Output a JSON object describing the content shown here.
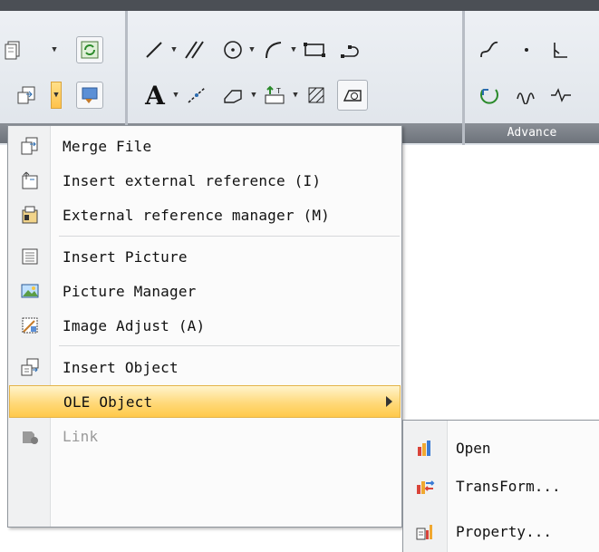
{
  "ribbon": {
    "panel_label": "Advance",
    "text_button": "A",
    "icons": {
      "row1": [
        "file-stack-icon",
        "refresh-icon",
        "line-icon",
        "parallel-lines-icon",
        "circle-icon",
        "arc-icon",
        "rectangle-icon",
        "polyline-icon",
        "spline-icon",
        "point-icon",
        "polygon-line-icon"
      ],
      "row2": [
        "insert-block-icon",
        "paint-icon",
        "text-icon",
        "construction-line-icon",
        "region-icon",
        "attribute-icon",
        "hatch-icon",
        "boundary-icon",
        "revolve-icon",
        "wave-icon",
        "zigzag-icon"
      ]
    }
  },
  "menu": {
    "items": [
      {
        "label": "Merge File",
        "icon": "merge-file-icon"
      },
      {
        "label": "Insert external reference (I)",
        "icon": "insert-xref-icon"
      },
      {
        "label": "External reference manager (M)",
        "icon": "xref-manager-icon"
      },
      {
        "label": "Insert Picture",
        "icon": "insert-picture-icon"
      },
      {
        "label": "Picture Manager",
        "icon": "picture-manager-icon"
      },
      {
        "label": "Image Adjust (A)",
        "icon": "image-adjust-icon"
      },
      {
        "label": "Insert Object",
        "icon": "insert-object-icon"
      },
      {
        "label": "OLE Object",
        "icon": "ole-object-icon",
        "state": "highlighted",
        "has_submenu": true
      },
      {
        "label": "Link",
        "icon": "link-icon",
        "state": "disabled"
      }
    ]
  },
  "submenu": {
    "items": [
      {
        "label": "Open",
        "icon": "open-chart-icon"
      },
      {
        "label": "TransForm...",
        "icon": "transform-chart-icon"
      },
      {
        "label": "Property...",
        "icon": "property-chart-icon"
      }
    ]
  },
  "colors": {
    "highlight_top": "#fff4cc",
    "highlight_bottom": "#ffc94a",
    "ribbon_label_bg": "#7a8088"
  }
}
